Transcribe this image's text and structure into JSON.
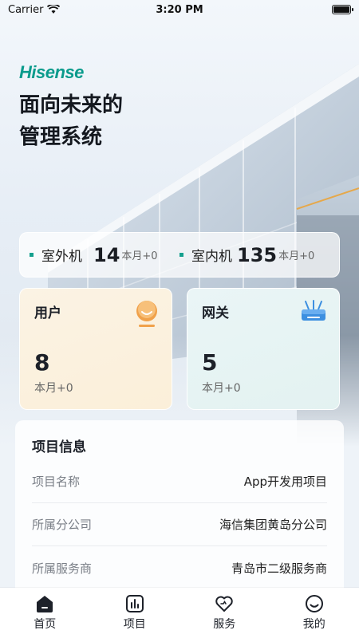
{
  "status_bar": {
    "carrier": "Carrier",
    "time": "3:20 PM"
  },
  "brand": {
    "logo_text": "Hisense",
    "color": "#0a9b8c"
  },
  "headline": {
    "line1": "面向未来的",
    "line2": "管理系统"
  },
  "stats": [
    {
      "label": "室外机",
      "value": "14",
      "sub": "本月+0"
    },
    {
      "label": "室内机",
      "value": "135",
      "sub": "本月+0"
    }
  ],
  "cards": {
    "users": {
      "title": "用户",
      "value": "8",
      "sub": "本月+0",
      "icon": "user-avatar-icon"
    },
    "gateways": {
      "title": "网关",
      "value": "5",
      "sub": "本月+0",
      "icon": "router-icon"
    }
  },
  "project_info": {
    "title": "项目信息",
    "rows": [
      {
        "key": "项目名称",
        "value": "App开发用项目"
      },
      {
        "key": "所属分公司",
        "value": "海信集团黄岛分公司"
      },
      {
        "key": "所属服务商",
        "value": "青岛市二级服务商"
      }
    ]
  },
  "tabs": [
    {
      "label": "首页",
      "icon": "home-icon",
      "active": true
    },
    {
      "label": "项目",
      "icon": "chart-icon",
      "active": false
    },
    {
      "label": "服务",
      "icon": "heart-icon",
      "active": false
    },
    {
      "label": "我的",
      "icon": "smile-icon",
      "active": false
    }
  ],
  "colors": {
    "accent": "#15a08e",
    "user_icon": "#f0a14a",
    "gateway_icon": "#3d8fe0"
  }
}
